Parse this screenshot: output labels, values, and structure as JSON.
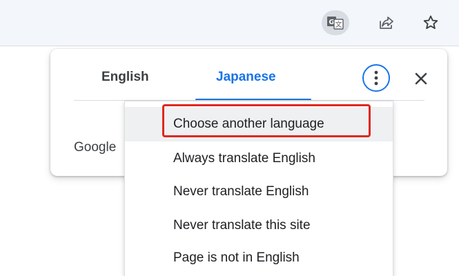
{
  "toolbar": {
    "icons": [
      "translate-icon",
      "share-icon",
      "star-icon"
    ]
  },
  "popup": {
    "tabs": [
      {
        "label": "English",
        "selected": false
      },
      {
        "label": "Japanese",
        "selected": true
      }
    ],
    "body_text": "Google"
  },
  "menu": {
    "items": [
      {
        "label": "Choose another language",
        "highlighted": true
      },
      {
        "label": "Always translate English"
      },
      {
        "label": "Never translate English"
      },
      {
        "label": "Never translate this site"
      },
      {
        "label": "Page is not in English"
      }
    ]
  },
  "colors": {
    "accent": "#1a73e8",
    "highlight_box": "#e0271e",
    "toolbar_bg": "#f3f6fb"
  }
}
